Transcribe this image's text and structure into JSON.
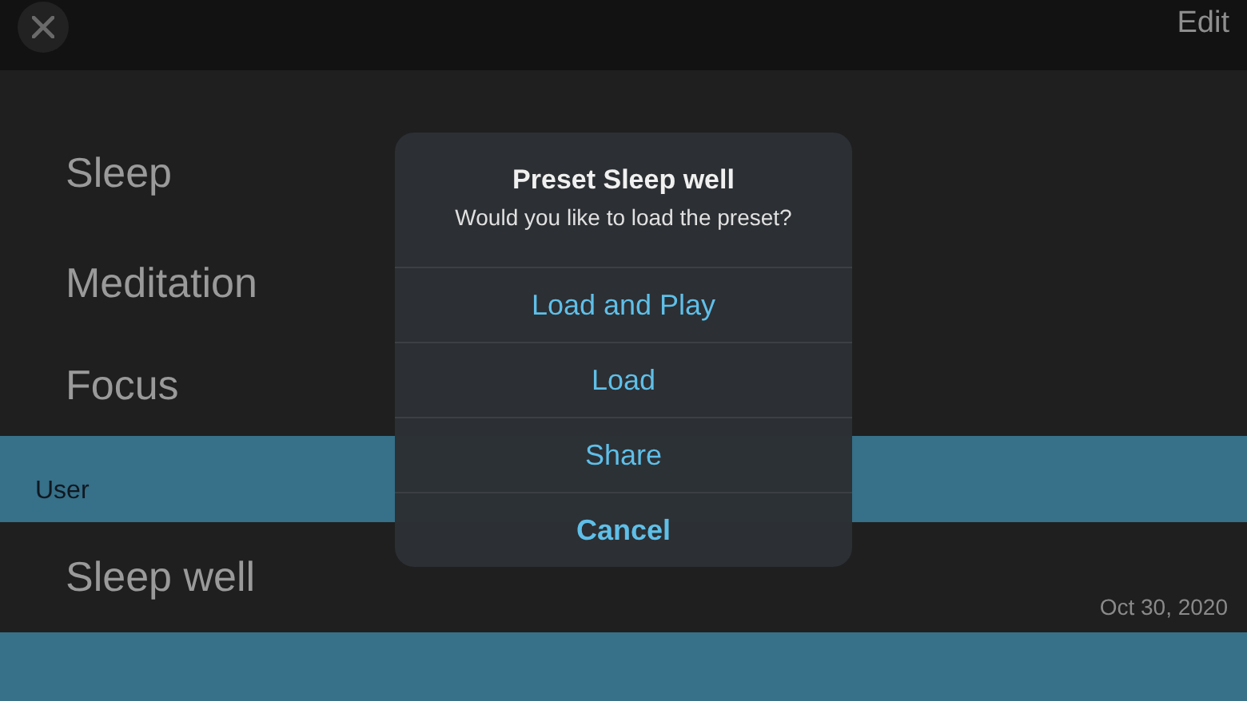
{
  "header": {
    "edit_label": "Edit"
  },
  "list_items": [
    {
      "label": "Sleep"
    },
    {
      "label": "Meditation"
    },
    {
      "label": "Focus"
    }
  ],
  "section": {
    "title": "User"
  },
  "user_items": [
    {
      "label": "Sleep well",
      "date": "Oct 30, 2020"
    }
  ],
  "dialog": {
    "title": "Preset Sleep well",
    "message": "Would you like to load the preset?",
    "actions": [
      {
        "label": "Load and Play",
        "kind": "default"
      },
      {
        "label": "Load",
        "kind": "default"
      },
      {
        "label": "Share",
        "kind": "default"
      },
      {
        "label": "Cancel",
        "kind": "cancel"
      }
    ]
  }
}
